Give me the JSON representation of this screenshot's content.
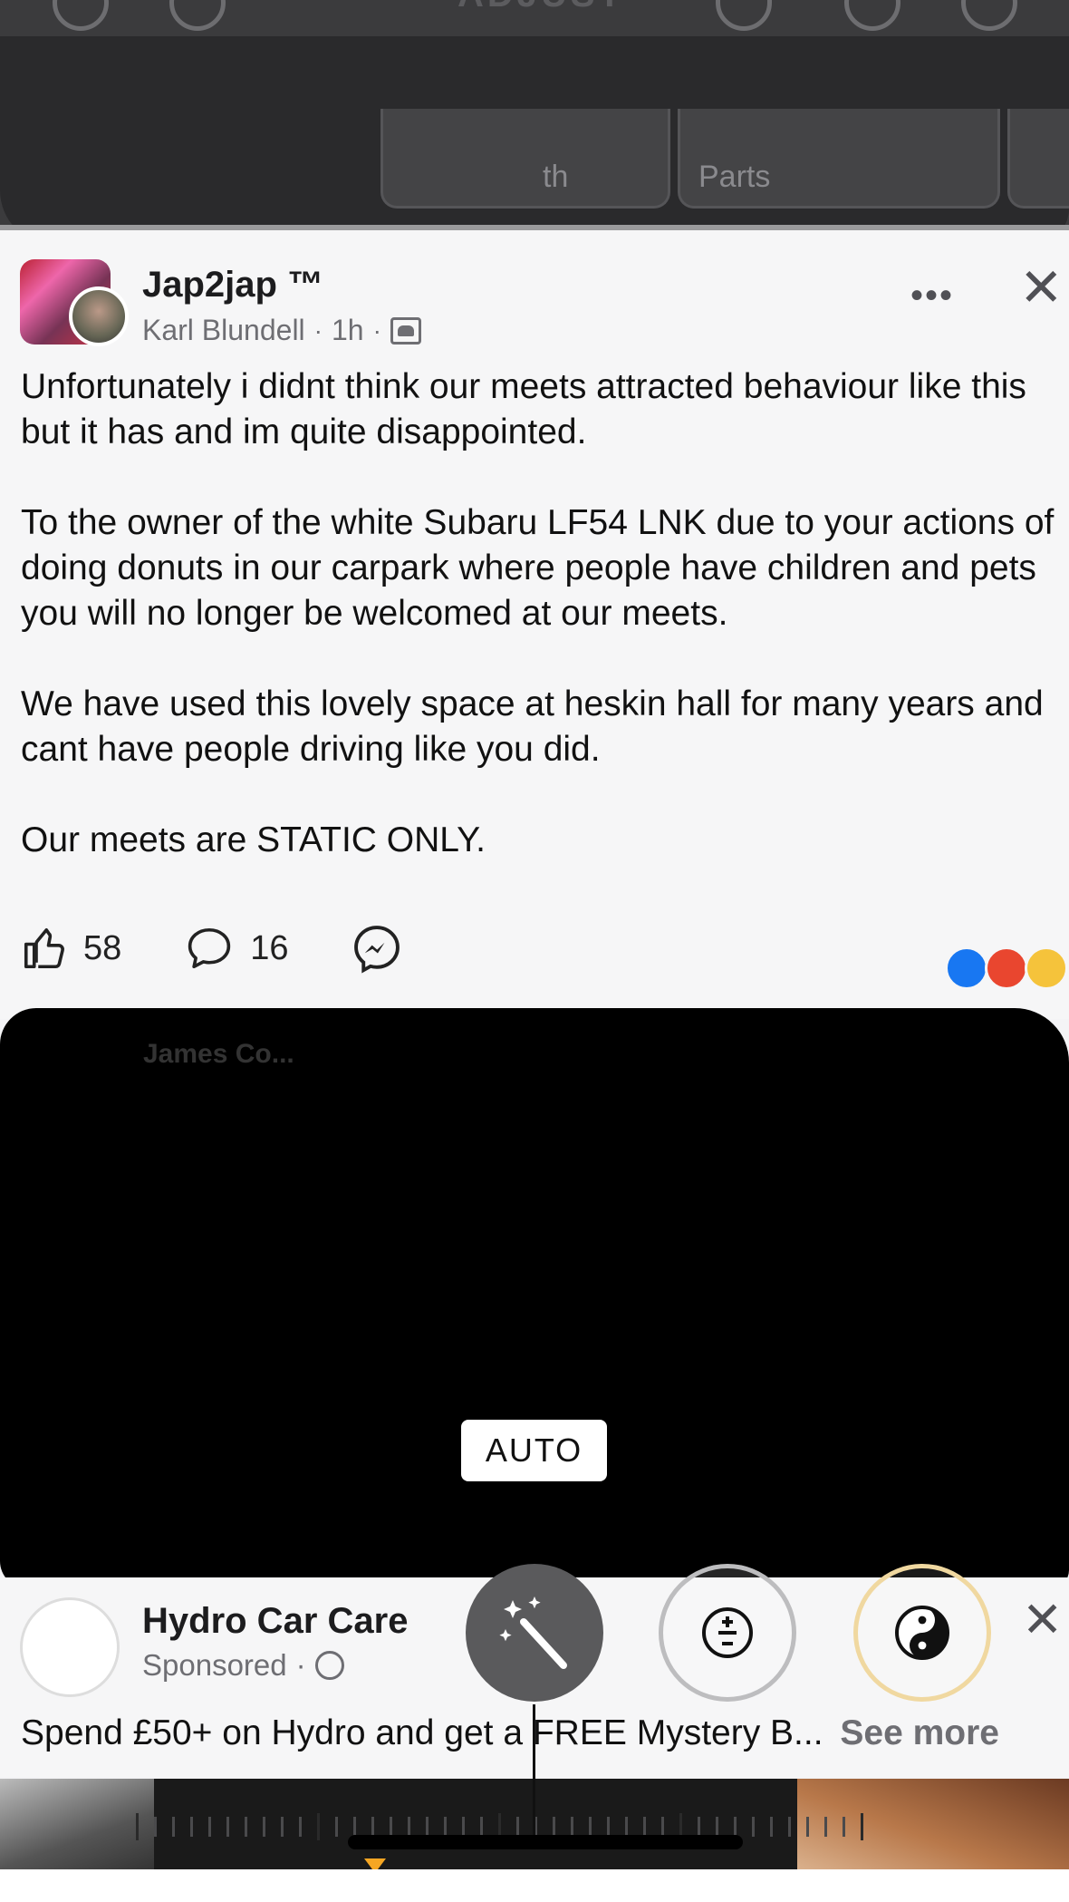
{
  "toolbar": {
    "mode_title": "ADJUST",
    "tabs": [
      "th",
      "Parts"
    ]
  },
  "post": {
    "group_name": "Jap2jap ™",
    "author": "Karl Blundell",
    "time": "1h",
    "separator": "·",
    "more_label": "•••",
    "close_label": "✕",
    "paragraphs": [
      "Unfortunately i didnt think our meets attracted behaviour like this but it has and im quite disappointed.",
      "To the owner of the white Subaru LF54 LNK due to your actions of doing donuts in our carpark where people have children and pets you will no longer be welcomed at our meets.",
      "We have used this lovely space at heskin hall for many years and cant have people driving like you did.",
      "Our meets are STATIC ONLY."
    ],
    "likes": "58",
    "comments": "16",
    "reactions": [
      "like",
      "angry",
      "wow"
    ]
  },
  "redacted_peek": "James Co...",
  "auto_label": "AUTO",
  "sponsored": {
    "name": "Hydro Car Care",
    "label": "Sponsored",
    "text": "Spend £50+ on Hydro and get a FREE Mystery B...",
    "see_more": "See more",
    "close_label": "✕"
  },
  "edit_controls": {
    "icons": [
      "magic-wand-icon",
      "exposure-icon",
      "brilliance-icon"
    ]
  },
  "colors": {
    "toolbar_bg": "#3b3b3d",
    "accent_marker": "#f5a623",
    "like_blue": "#1877f2",
    "angry_red": "#e9462f",
    "wow_yellow": "#f5c33b"
  }
}
